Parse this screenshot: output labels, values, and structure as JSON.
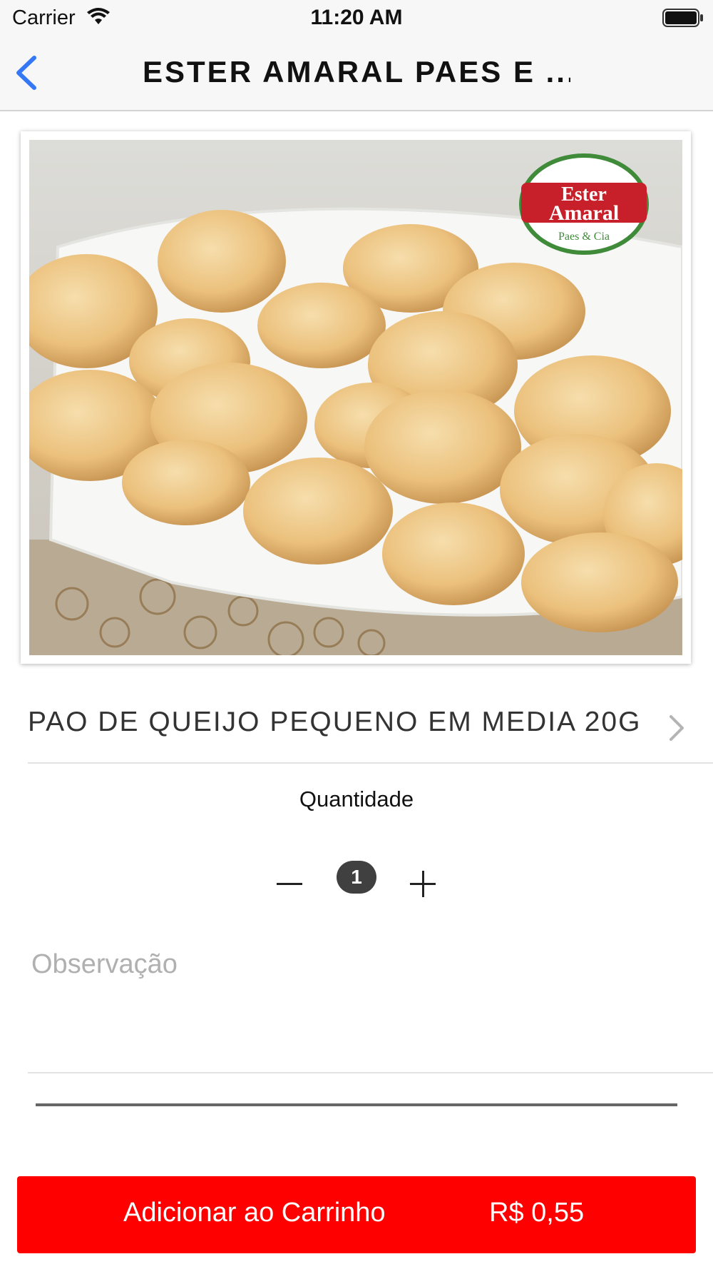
{
  "status_bar": {
    "carrier": "Carrier",
    "time": "11:20 AM",
    "icons": [
      "wifi-icon",
      "battery-icon"
    ]
  },
  "nav": {
    "title": "ESTER AMARAL PAES E ...",
    "back_icon": "chevron-left-icon"
  },
  "product": {
    "image_logo": {
      "line1": "Ester",
      "line2": "Amaral",
      "line3": "Paes & Cia"
    },
    "name": "PAO DE QUEIJO PEQUENO EM MEDIA 20G",
    "chevron_icon": "chevron-right-icon"
  },
  "quantity": {
    "label": "Quantidade",
    "value": "1",
    "decrement_icon": "minus-icon",
    "increment_icon": "plus-icon"
  },
  "observation": {
    "placeholder": "Observação",
    "value": ""
  },
  "cart_button": {
    "label": "Adicionar ao Carrinho",
    "price": "R$ 0,55"
  },
  "colors": {
    "accent_back": "#3478f6",
    "button": "#ff0000",
    "badge": "#404040"
  }
}
